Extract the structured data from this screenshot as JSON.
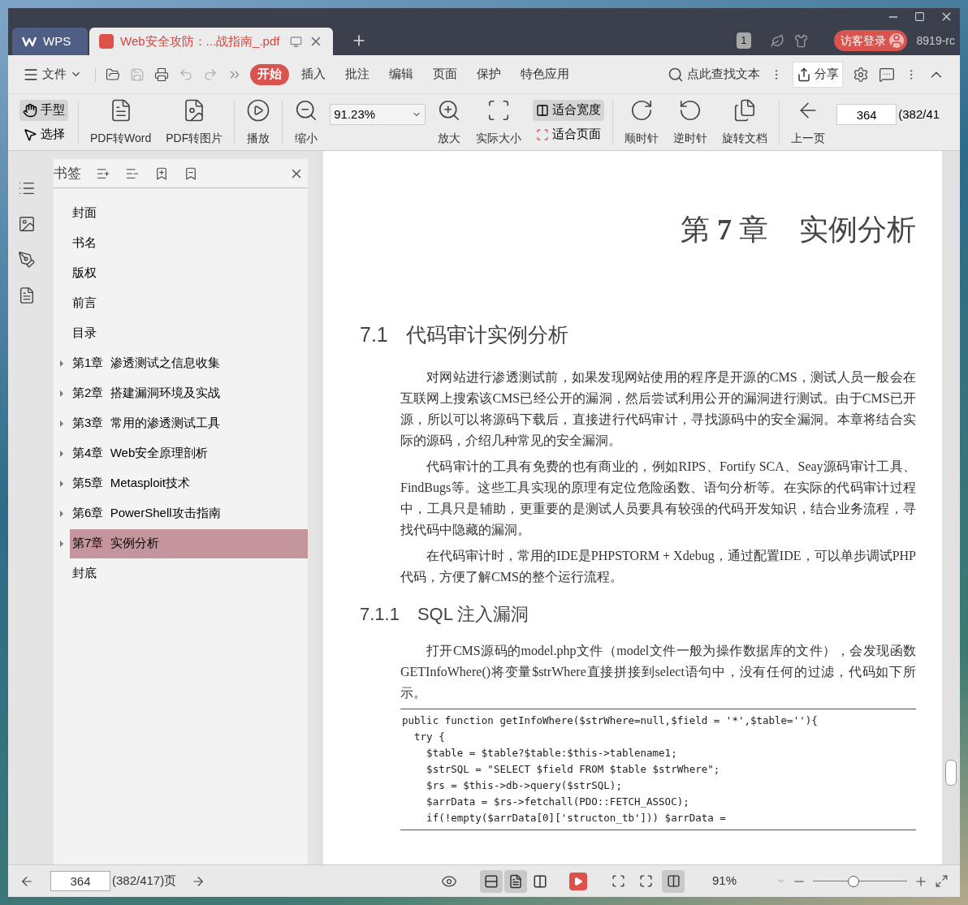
{
  "window": {
    "tabs": [
      {
        "label": "WPS",
        "kind": "home",
        "selected": false
      },
      {
        "label": "Web安全攻防：...战指南_.pdf",
        "kind": "document",
        "selected": true
      }
    ],
    "badge": "1",
    "login": "访客登录",
    "user": "8919-rc"
  },
  "menu": {
    "file": "文件",
    "tabs": [
      {
        "label": "开始",
        "selected": true
      },
      {
        "label": "插入",
        "selected": false
      },
      {
        "label": "批注",
        "selected": false
      },
      {
        "label": "编辑",
        "selected": false
      },
      {
        "label": "页面",
        "selected": false
      },
      {
        "label": "保护",
        "selected": false
      },
      {
        "label": "特色应用",
        "selected": false
      }
    ],
    "search": "点此查找文本",
    "share": "分享"
  },
  "toolbar": {
    "hand": {
      "label": "手型",
      "selected": true
    },
    "select": {
      "label": "选择",
      "selected": false
    },
    "pdf_to_word": "PDF转Word",
    "pdf_to_image": "PDF转图片",
    "play": "播放",
    "zoom_out": "缩小",
    "zoom_value": "91.23%",
    "zoom_in": "放大",
    "actual_size": "实际大小",
    "fit_width": {
      "label": "适合宽度",
      "selected": true
    },
    "fit_page": {
      "label": "适合页面",
      "selected": false
    },
    "clockwise": "顺时针",
    "counterclockwise": "逆时针",
    "rotate_document": "旋转文档",
    "previous_page": "上一页",
    "page": "364",
    "page_total": "(382/41"
  },
  "bookmarks": {
    "title": "书签",
    "items": [
      {
        "label": "封面",
        "expandable": false,
        "selected": false
      },
      {
        "label": "书名",
        "expandable": false,
        "selected": false
      },
      {
        "label": "版权",
        "expandable": false,
        "selected": false
      },
      {
        "label": "前言",
        "expandable": false,
        "selected": false
      },
      {
        "label": "目录",
        "expandable": false,
        "selected": false
      },
      {
        "label": "第1章  渗透测试之信息收集",
        "expandable": true,
        "selected": false
      },
      {
        "label": "第2章  搭建漏洞环境及实战",
        "expandable": true,
        "selected": false
      },
      {
        "label": "第3章  常用的渗透测试工具",
        "expandable": true,
        "selected": false
      },
      {
        "label": "第4章  Web安全原理剖析",
        "expandable": true,
        "selected": false
      },
      {
        "label": "第5章  Metasploit技术",
        "expandable": true,
        "selected": false
      },
      {
        "label": "第6章  PowerShell攻击指南",
        "expandable": true,
        "selected": false
      },
      {
        "label": "第7章  实例分析",
        "expandable": true,
        "selected": true
      },
      {
        "label": "封底",
        "expandable": false,
        "selected": false
      }
    ]
  },
  "document": {
    "chapter": "第 **7** 章",
    "chapter_title": "实例分析",
    "section_number": "7.1",
    "section_title": "代码审计实例分析",
    "paragraphs": [
      "对网站进行渗透测试前，如果发现网站使用的程序是开源的CMS，测试人员一般会在互联网上搜索该CMS已经公开的漏洞，然后尝试利用公开的漏洞进行测试。由于CMS已开源，所以可以将源码下载后，直接进行代码审计，寻找源码中的安全漏洞。本章将结合实际的源码，介绍几种常见的安全漏洞。",
      "代码审计的工具有免费的也有商业的，例如RIPS、Fortify SCA、Seay源码审计工具、FindBugs等。这些工具实现的原理有定位危险函数、语句分析等。在实际的代码审计过程中，工具只是辅助，更重要的是测试人员要具有较强的代码开发知识，结合业务流程，寻找代码中隐藏的漏洞。",
      "在代码审计时，常用的IDE是PHPSTORM + Xdebug，通过配置IDE，可以单步调试PHP代码，方便了解CMS的整个运行流程。"
    ],
    "subsection_number": "7.1.1",
    "subsection_title": "SQL 注入漏洞",
    "paragraphs_2": [
      "打开CMS源码的model.php文件（model文件一般为操作数据库的文件），会发现函数GETInfoWhere()将变量$strWhere直接拼接到select语句中，没有任何的过滤，代码如下所示。"
    ],
    "code": [
      "public function getInfoWhere($strWhere=null,$field = '*',$table=''){",
      "  try {",
      "    $table = $table?$table:$this->tablename1;",
      "    $strSQL = \"SELECT $field FROM $table $strWhere\";",
      "    $rs = $this->db->query($strSQL);",
      "    $arrData = $rs->fetchall(PDO::FETCH_ASSOC);",
      "    if(!empty($arrData[0]['structon_tb'])) $arrData ="
    ]
  },
  "status_bar": {
    "page": "364",
    "page_total": "(382/417)页",
    "zoom": "91%",
    "zoom_slider": {
      "level": 0.43
    },
    "view_modes": [
      {
        "kind": "continuous",
        "selected": true
      },
      {
        "kind": "single",
        "selected": true
      },
      {
        "kind": "double",
        "selected": false
      }
    ],
    "fit_modes": [
      {
        "kind": "actual",
        "selected": false
      },
      {
        "kind": "page",
        "selected": false
      },
      {
        "kind": "width",
        "selected": true
      }
    ]
  }
}
